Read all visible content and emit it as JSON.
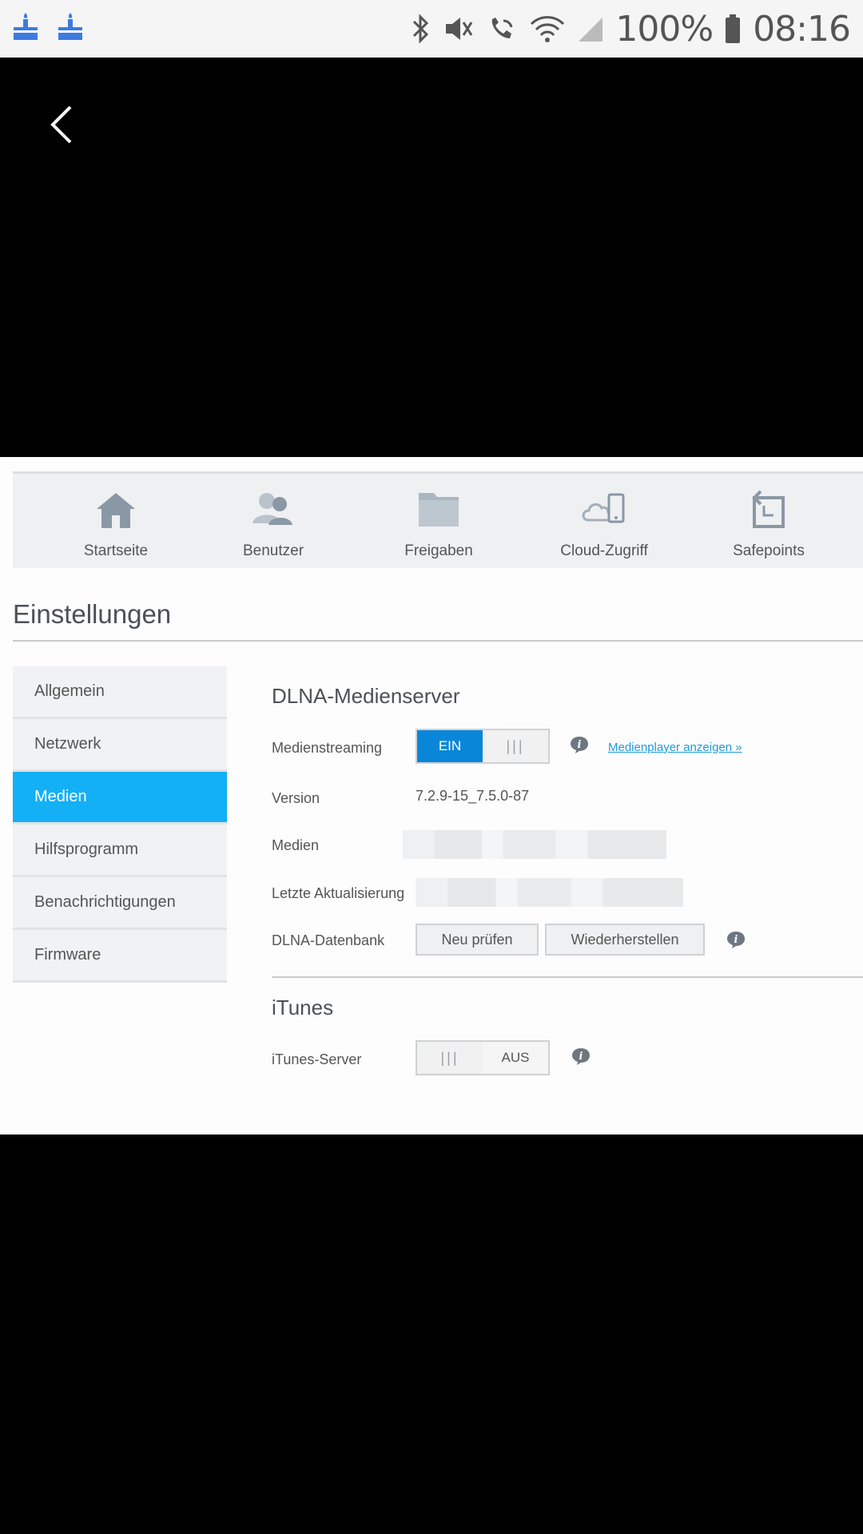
{
  "status_bar": {
    "battery": "100%",
    "time": "08:16"
  },
  "nav": [
    {
      "label": "Startseite",
      "icon": "home-icon"
    },
    {
      "label": "Benutzer",
      "icon": "users-icon"
    },
    {
      "label": "Freigaben",
      "icon": "folder-icon"
    },
    {
      "label": "Cloud-Zugriff",
      "icon": "cloud-device-icon"
    },
    {
      "label": "Safepoints",
      "icon": "safepoint-icon"
    }
  ],
  "page_title": "Einstellungen",
  "sidebar": {
    "items": [
      {
        "label": "Allgemein"
      },
      {
        "label": "Netzwerk"
      },
      {
        "label": "Medien"
      },
      {
        "label": "Hilfsprogramm"
      },
      {
        "label": "Benachrichtigungen"
      },
      {
        "label": "Firmware"
      }
    ],
    "active": "Medien"
  },
  "dlna": {
    "heading": "DLNA-Medienserver",
    "streaming_label": "Medienstreaming",
    "streaming_on": "EIN",
    "player_link": "Medienplayer anzeigen »",
    "version_label": "Version",
    "version_value": "7.2.9-15_7.5.0-87",
    "media_label": "Medien",
    "last_update_label": "Letzte Aktualisierung",
    "db_label": "DLNA-Datenbank",
    "rescan_button": "Neu prüfen",
    "restore_button": "Wiederherstellen"
  },
  "itunes": {
    "heading": "iTunes",
    "server_label": "iTunes-Server",
    "server_off": "AUS"
  },
  "colors": {
    "accent": "#13b0f5",
    "toggle_on": "#0a86d9"
  }
}
